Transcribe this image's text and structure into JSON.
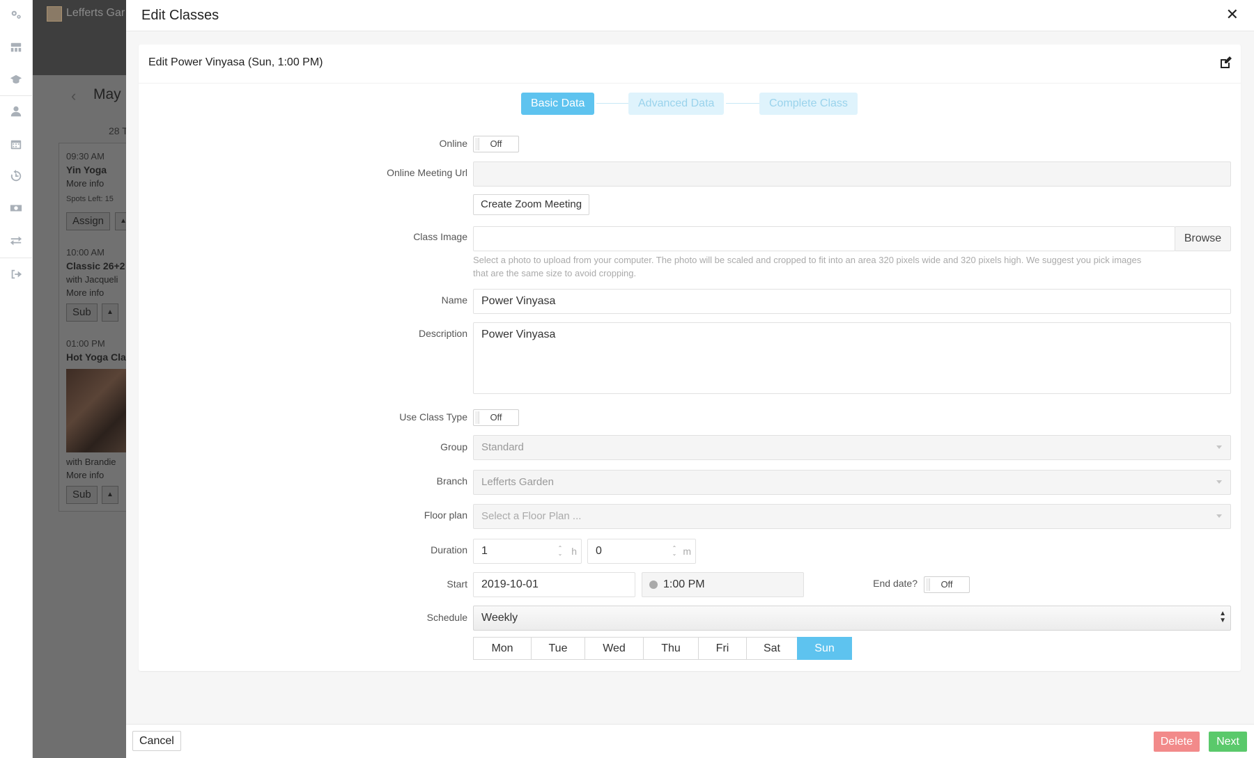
{
  "background_app": {
    "brand": "Lefferts Gar",
    "month": "May",
    "day_header": "28 T",
    "classes": [
      {
        "time": "09:30 AM",
        "name": "Yin Yoga",
        "more": "More info",
        "spots": "Spots Left: 15",
        "button": "Assign"
      },
      {
        "time": "10:00 AM",
        "name": "Classic 26+2",
        "instructor": "with Jacqueli",
        "more": "More info",
        "button": "Sub"
      },
      {
        "time": "01:00 PM",
        "name": "Hot Yoga Cla",
        "instructor": "with Brandie",
        "more": "More info",
        "button": "Sub"
      }
    ]
  },
  "modal": {
    "title": "Edit Classes",
    "subtitle": "Edit Power Vinyasa (Sun, 1:00 PM)",
    "steps": [
      "Basic Data",
      "Advanced Data",
      "Complete Class"
    ],
    "active_step": 0
  },
  "form": {
    "online": {
      "label": "Online",
      "value": "Off"
    },
    "meeting_url": {
      "label": "Online Meeting Url",
      "value": ""
    },
    "zoom_button": "Create Zoom Meeting",
    "class_image": {
      "label": "Class Image",
      "browse": "Browse",
      "help_line1": "Select a photo to upload from your computer. The photo will be scaled and cropped to fit into an area 320 pixels wide and 320 pixels high. We suggest you pick images",
      "help_line2": "that are the same size to avoid cropping."
    },
    "name": {
      "label": "Name",
      "value": "Power Vinyasa"
    },
    "description": {
      "label": "Description",
      "value": "Power Vinyasa"
    },
    "use_class_type": {
      "label": "Use Class Type",
      "value": "Off"
    },
    "group": {
      "label": "Group",
      "value": "Standard"
    },
    "branch": {
      "label": "Branch",
      "value": "Lefferts Garden"
    },
    "floor_plan": {
      "label": "Floor plan",
      "placeholder": "Select a Floor Plan ..."
    },
    "duration": {
      "label": "Duration",
      "hours": "1",
      "hours_unit": "h",
      "minutes": "0",
      "minutes_unit": "m"
    },
    "start": {
      "label": "Start",
      "date": "2019-10-01",
      "time": "1:00 PM"
    },
    "end_date": {
      "label": "End date?",
      "value": "Off"
    },
    "schedule": {
      "label": "Schedule",
      "value": "Weekly"
    },
    "days": [
      {
        "label": "Mon",
        "selected": false
      },
      {
        "label": "Tue",
        "selected": false
      },
      {
        "label": "Wed",
        "selected": false
      },
      {
        "label": "Thu",
        "selected": false
      },
      {
        "label": "Fri",
        "selected": false
      },
      {
        "label": "Sat",
        "selected": false
      },
      {
        "label": "Sun",
        "selected": true
      }
    ]
  },
  "footer": {
    "cancel": "Cancel",
    "delete": "Delete",
    "next": "Next"
  },
  "colors": {
    "accent": "#5ec3ef",
    "delete": "#f28a8a",
    "next": "#5ac96b"
  },
  "rail_icons": [
    "gears-icon",
    "dashboard-icon",
    "graduation-cap-icon",
    "user-icon",
    "calendar-icon",
    "history-icon",
    "money-icon",
    "transfer-icon",
    "sign-out-icon"
  ]
}
